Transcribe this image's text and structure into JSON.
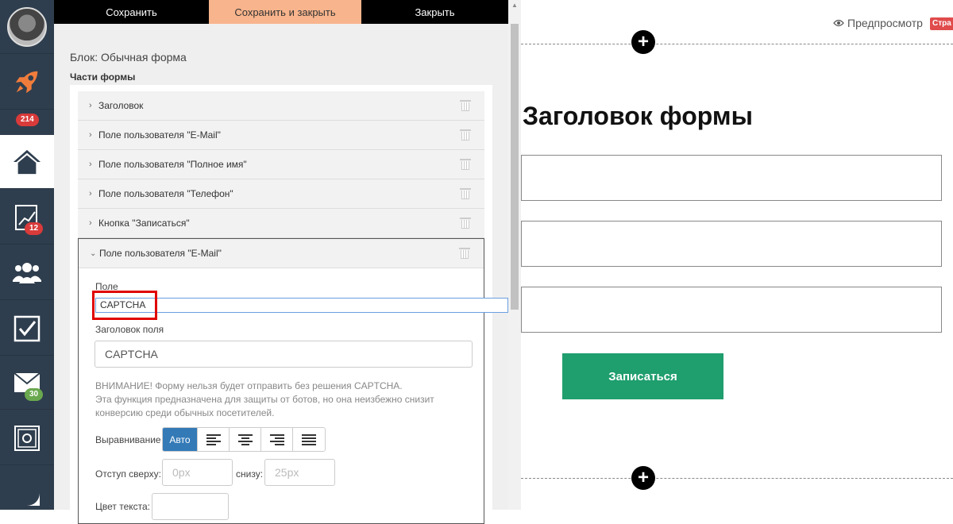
{
  "sidebar": {
    "badges": {
      "rocket": "214",
      "stats": "12",
      "mail": "30"
    }
  },
  "toolbar": {
    "save_label": "Сохранить",
    "save_close_label": "Сохранить и закрыть",
    "close_label": "Закрыть"
  },
  "editor": {
    "block_title": "Блок: Обычная форма",
    "parts_title": "Части формы",
    "parts": [
      {
        "label": "Заголовок"
      },
      {
        "label": "Поле пользователя \"E-Mail\""
      },
      {
        "label": "Поле пользователя \"Полное имя\""
      },
      {
        "label": "Поле пользователя \"Телефон\""
      },
      {
        "label": "Кнопка \"Записаться\""
      }
    ],
    "expanded": {
      "header": "Поле пользователя \"E-Mail\"",
      "field_label": "Поле",
      "field_value": "CAPTCHA",
      "field_title_label": "Заголовок поля",
      "field_title_value": "CAPTCHA",
      "warning_1": "ВНИМАНИЕ! Форму нельзя будет отправить без решения CAPTCHA.",
      "warning_2": "Эта функция предназначена для защиты от ботов, но она неизбежно снизит",
      "warning_3": "конверсию среди обычных посетителей.",
      "align_label": "Выравнивание",
      "align_auto": "Авто",
      "margin_top_label": "Отступ сверху:",
      "margin_top_placeholder": "0px",
      "margin_bottom_label": "снизу:",
      "margin_bottom_placeholder": "25px",
      "text_color_label": "Цвет текста:"
    }
  },
  "preview": {
    "preview_link": "Предпросмотр",
    "tag_text": "Стра",
    "form_title": "Заголовок формы",
    "submit_label": "Записаться"
  },
  "colors": {
    "sidebar_bg": "#2f3e4e",
    "accent_orange": "#f8b48c",
    "submit_green": "#1f9e6e",
    "align_active_blue": "#337ab7",
    "highlight_red": "#e00000"
  }
}
